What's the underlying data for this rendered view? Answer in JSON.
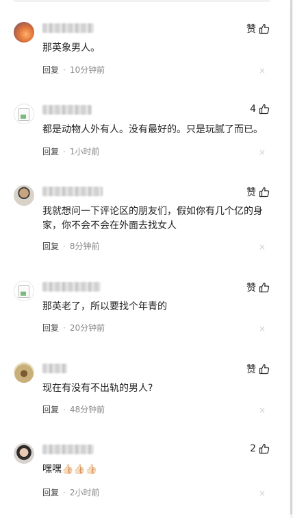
{
  "comments": [
    {
      "text": "那英象男人。",
      "likes": "赞",
      "reply": "回复",
      "time": "10分钟前",
      "avatar": "sunset-avatar"
    },
    {
      "text": "都是动物人外有人。没有最好的。只是玩腻了而已。",
      "likes": "4",
      "reply": "回复",
      "time": "1小时前",
      "avatar": "broken-image-avatar"
    },
    {
      "text": "我就想问一下评论区的朋友们，假如你有几个亿的身家，你不会不会在外面去找女人",
      "likes": "赞",
      "reply": "回复",
      "time": "8分钟前",
      "avatar": "man-avatar"
    },
    {
      "text": "那英老了，所以要找个年青的",
      "likes": "赞",
      "reply": "回复",
      "time": "20分钟前",
      "avatar": "broken-image-avatar"
    },
    {
      "text": "现在有没有不出轨的男人?",
      "likes": "赞",
      "reply": "回复",
      "time": "48分钟前",
      "avatar": "cartoon-avatar"
    },
    {
      "text": "嘿嘿👍🏻👍🏻👍🏻",
      "likes": "2",
      "reply": "回复",
      "time": "2小时前",
      "avatar": "woman-avatar"
    }
  ],
  "ui": {
    "dot": "·",
    "close_glyph": "×"
  }
}
